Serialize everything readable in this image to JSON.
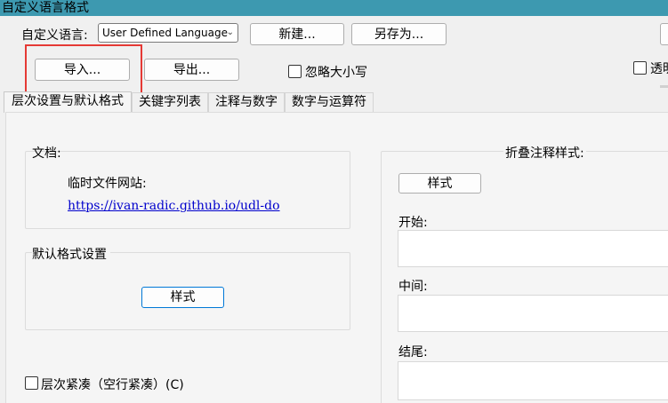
{
  "window": {
    "title": "自定义语言格式"
  },
  "toolbar": {
    "language_label": "自定义语言:",
    "language_selected": "User Defined Language",
    "new_button": "新建...",
    "save_as_button": "另存为...",
    "import_button": "导入...",
    "export_button": "导出...",
    "ignore_case_label": "忽略大小写",
    "transparent_label": "透明"
  },
  "tabs": [
    {
      "label": "层次设置与默认格式"
    },
    {
      "label": "关键字列表"
    },
    {
      "label": "注释与数字"
    },
    {
      "label": "数字与运算符"
    }
  ],
  "documents": {
    "header": "文档:",
    "temp_site_label": "临时文件网站:",
    "link": "https://ivan-radic.github.io/udl-do"
  },
  "default_style": {
    "header": "默认格式设置",
    "style_button": "样式"
  },
  "compact_fold": {
    "label": "层次紧凑（空行紧凑）(C)"
  },
  "fold_comment": {
    "header": "折叠注释样式:",
    "style_button": "样式",
    "open_label": "开始:",
    "middle_label": "中间:",
    "close_label": "结尾:"
  },
  "colors": {
    "titlebar": "#3d99b0",
    "highlight": "#e53935",
    "link": "#0000cc",
    "focus": "#0078d7"
  }
}
